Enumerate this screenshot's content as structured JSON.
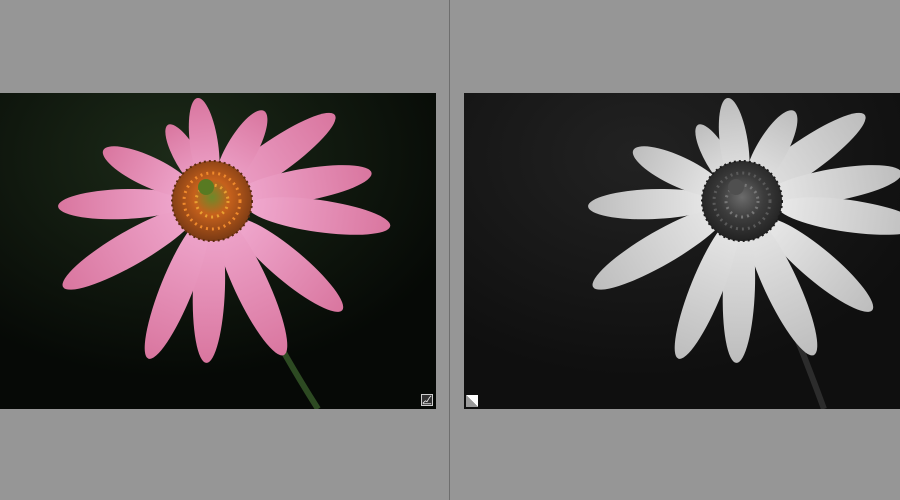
{
  "window": {
    "mode": "before-after-compare",
    "background_color": "#969696"
  },
  "panels": [
    {
      "role": "before",
      "image": "pink-coneflower-color",
      "petal_color": "#e694bf",
      "center_color": "#d4641f",
      "badge_icon": "histogram-icon"
    },
    {
      "role": "after",
      "image": "pink-coneflower-monochrome",
      "petal_color": "#d8d8d8",
      "center_color": "#3a3a3a",
      "badge_icon": "corner-flag-icon"
    }
  ]
}
